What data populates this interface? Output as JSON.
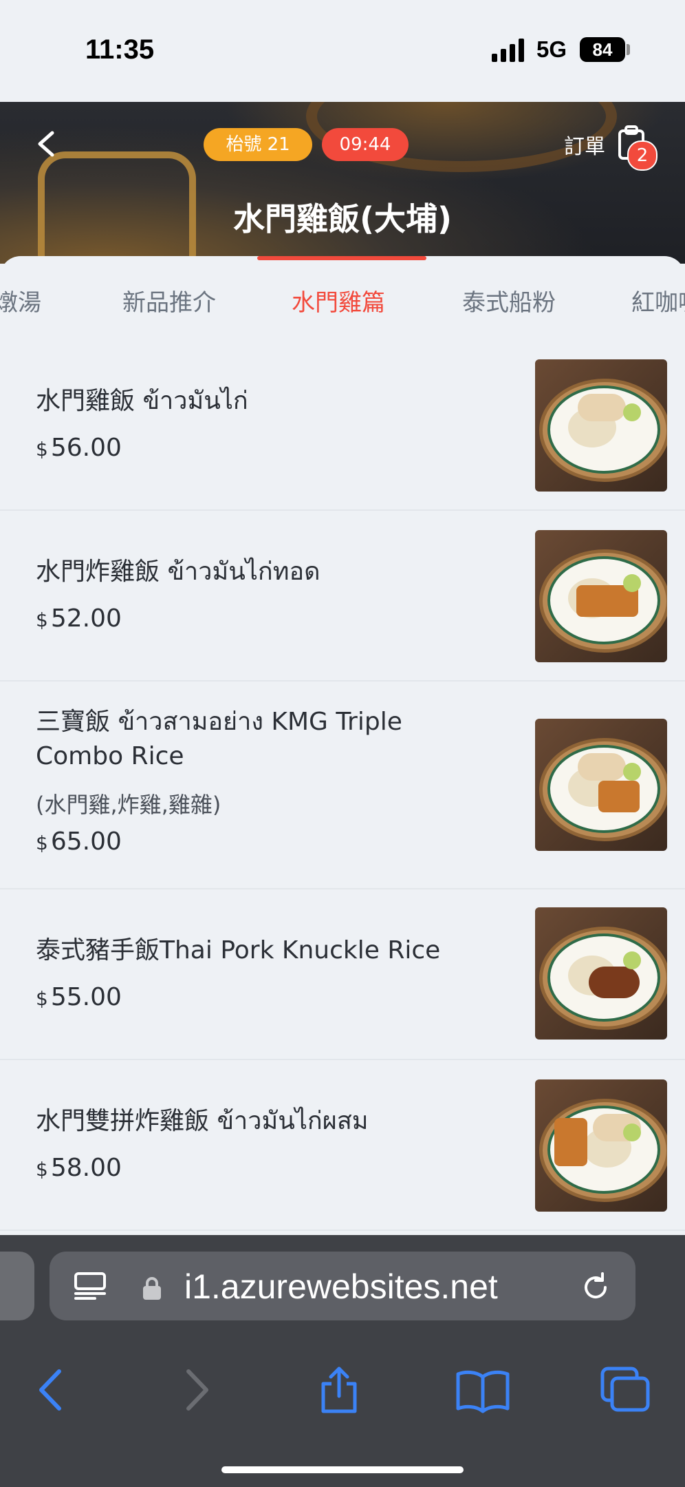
{
  "status_bar": {
    "time": "11:35",
    "network": "5G",
    "battery": "84"
  },
  "header": {
    "table_label": "枱號 21",
    "timer": "09:44",
    "order_label": "訂單",
    "order_count": "2",
    "shop_title": "水門雞飯(大埔)"
  },
  "tabs": [
    {
      "label": "燉湯"
    },
    {
      "label": "新品推介"
    },
    {
      "label": "水門雞篇"
    },
    {
      "label": "泰式船粉"
    },
    {
      "label": "紅咖喱"
    }
  ],
  "active_tab": "水門雞篇",
  "currency_symbol": "$",
  "menu": [
    {
      "name": "水門雞飯 ข้าวมันไก่",
      "desc": "",
      "price": "56.00"
    },
    {
      "name": "水門炸雞飯 ข้าวมันไก่ทอด",
      "desc": "",
      "price": "52.00"
    },
    {
      "name": "三寶飯 ข้าวสามอย่าง KMG Triple Combo Rice",
      "desc": "(水門雞,炸雞,雞雜)",
      "price": "65.00"
    },
    {
      "name": "泰式豬手飯Thai Pork Knuckle Rice",
      "desc": "",
      "price": "55.00"
    },
    {
      "name": "水門雙拼炸雞飯 ข้าวมันไก่ผสม",
      "desc": "",
      "price": "58.00"
    }
  ],
  "browser": {
    "url": "i1.azurewebsites.net"
  },
  "colors": {
    "accent": "#f24a3c",
    "table_pill": "#f5a623",
    "link_blue": "#3b82f6"
  }
}
